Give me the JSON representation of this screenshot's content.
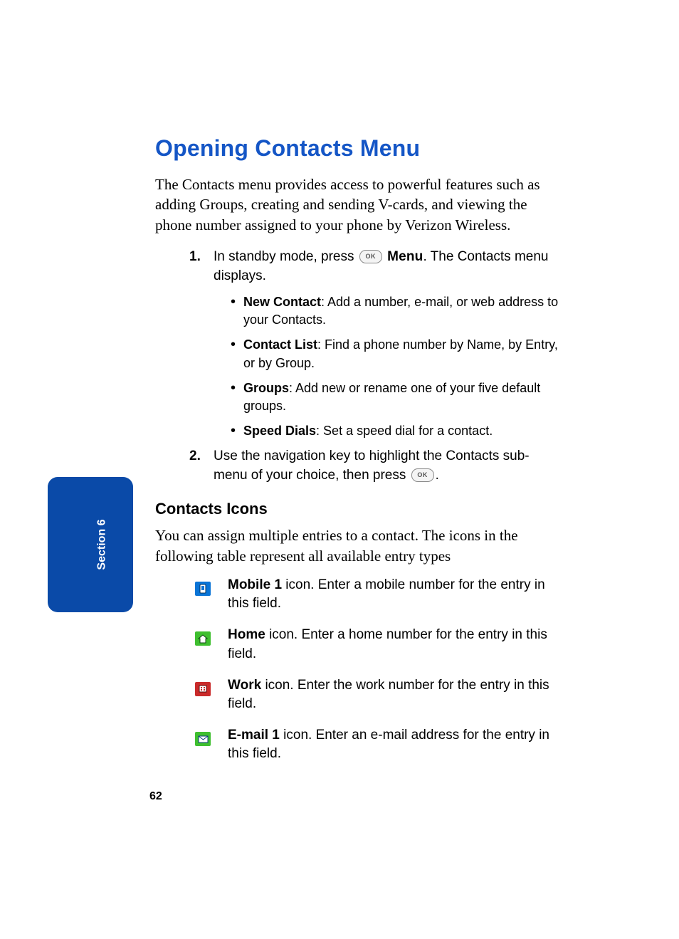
{
  "title": "Opening Contacts Menu",
  "intro": "The Contacts menu provides access to powerful features such as adding Groups, creating and sending V-cards, and viewing the phone number assigned to your phone by Verizon Wireless.",
  "section_tab": "Section 6",
  "page_number": "62",
  "ok_label": "OK",
  "steps": [
    {
      "num": "1.",
      "pre": "In standby mode, press ",
      "bold_after_ok": "Menu",
      "post": ". The Contacts menu displays.",
      "bullets": [
        {
          "label": "New Contact",
          "desc": ": Add a number, e-mail, or web address to your Contacts."
        },
        {
          "label": "Contact List",
          "desc": ": Find a phone number by Name, by Entry, or by Group."
        },
        {
          "label": "Groups",
          "desc": ": Add new or rename one of your five default groups."
        },
        {
          "label": "Speed Dials",
          "desc": ": Set a speed dial for a contact."
        }
      ]
    },
    {
      "num": "2.",
      "pre": "Use the navigation key to highlight the Contacts sub-menu of your choice, then press ",
      "post": "."
    }
  ],
  "subhead": "Contacts Icons",
  "sub_intro": "You can assign multiple entries to a contact. The icons in the following table represent all available entry types",
  "icons": [
    {
      "name": "mobile-1-icon",
      "color": "#0a74d6",
      "label": "Mobile 1",
      "desc": " icon. Enter a mobile number for the entry in this field."
    },
    {
      "name": "home-icon",
      "color": "#3fbf2f",
      "label": "Home",
      "desc": " icon. Enter a home number for the entry in this field."
    },
    {
      "name": "work-icon",
      "color": "#c92a2a",
      "label": "Work",
      "desc": " icon. Enter the work number for the entry in this field."
    },
    {
      "name": "email-1-icon",
      "color": "#3fbf2f",
      "label": "E-mail 1",
      "desc": " icon. Enter an e-mail address for the entry in this field."
    }
  ]
}
